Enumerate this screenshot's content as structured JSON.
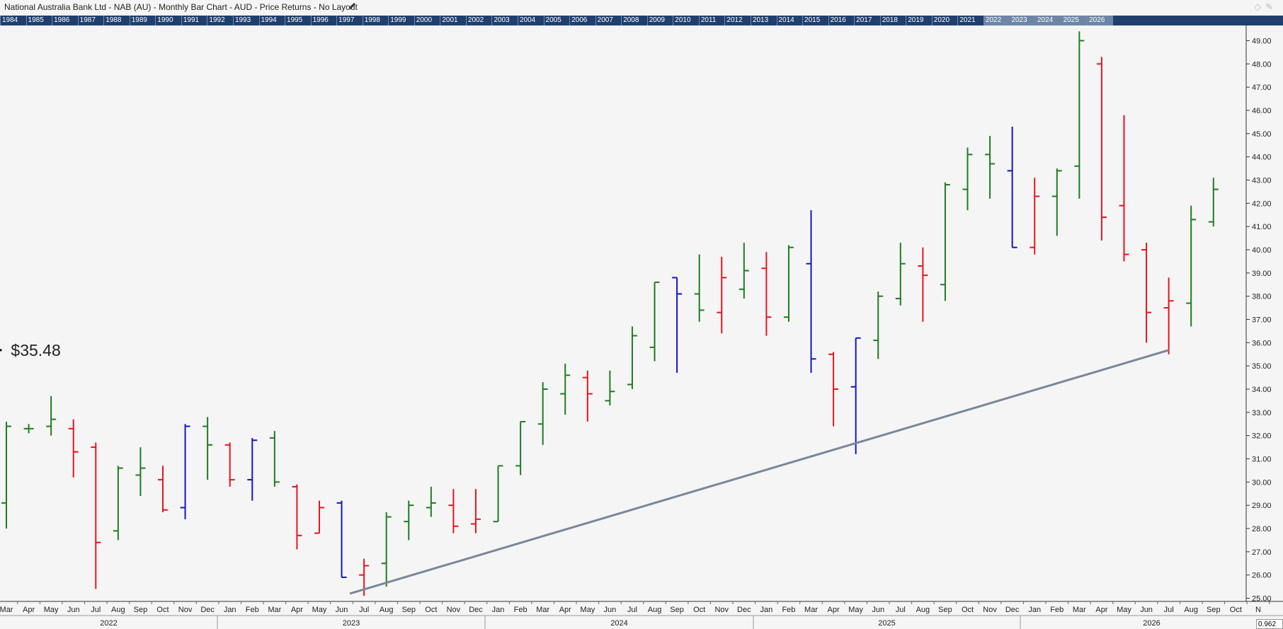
{
  "header": {
    "title": "National Australia Bank Ltd - NAB (AU) - Monthly Bar Chart - AUD - Price Returns - No Layout",
    "edit_icon": "pencil-icon",
    "window_icons": [
      "diamond-icon",
      "pin-icon"
    ]
  },
  "year_strip": {
    "years": [
      "1984",
      "1985",
      "1986",
      "1987",
      "1988",
      "1989",
      "1990",
      "1991",
      "1992",
      "1993",
      "1994",
      "1995",
      "1996",
      "1997",
      "1998",
      "1999",
      "2000",
      "2001",
      "2002",
      "2003",
      "2004",
      "2005",
      "2006",
      "2007",
      "2008",
      "2009",
      "2010",
      "2011",
      "2012",
      "2013",
      "2014",
      "2015",
      "2016",
      "2017",
      "2018",
      "2019",
      "2020",
      "2021",
      "2022",
      "2023",
      "2024",
      "2025",
      "2026"
    ],
    "highlight_from": "2022",
    "highlight_to": "2026"
  },
  "price_label": "$35.48",
  "status_value": "0.962",
  "colors": {
    "up": "#1e7d1e",
    "down": "#e8141e",
    "outside": "#1414c8",
    "trendline": "#778899",
    "level": "#000000"
  },
  "chart_data": {
    "type": "ohlc",
    "title": "National Australia Bank Ltd - NAB (AU) - Monthly Bar Chart - AUD - Price Returns - No Layout",
    "grid": false,
    "ylim": [
      25.0,
      49.5
    ],
    "y_ticks": [
      "25.00",
      "26.00",
      "27.00",
      "28.00",
      "29.00",
      "30.00",
      "31.00",
      "32.00",
      "33.00",
      "34.00",
      "35.00",
      "36.00",
      "37.00",
      "38.00",
      "39.00",
      "40.00",
      "41.00",
      "42.00",
      "43.00",
      "44.00",
      "45.00",
      "46.00",
      "47.00",
      "48.00",
      "49.00"
    ],
    "x_month_labels": [
      "Mar",
      "Apr",
      "May",
      "Jun",
      "Jul",
      "Aug",
      "Sep",
      "Oct",
      "Nov",
      "Dec",
      "Jan",
      "Feb",
      "Mar",
      "Apr",
      "May",
      "Jun",
      "Jul",
      "Aug",
      "Sep",
      "Oct",
      "Nov",
      "Dec",
      "Jan",
      "Feb",
      "Mar",
      "Apr",
      "May",
      "Jun",
      "Jul",
      "Aug",
      "Sep",
      "Oct",
      "Nov",
      "Dec",
      "Jan",
      "Feb",
      "Mar",
      "Apr",
      "May",
      "Jun",
      "Jul",
      "Aug",
      "Sep",
      "Oct",
      "Nov",
      "Dec",
      "Jan",
      "Feb",
      "Mar",
      "Apr",
      "May",
      "Jun",
      "Jul",
      "Aug",
      "Sep",
      "Oct",
      "N"
    ],
    "x_year_labels": [
      "2022",
      "2023",
      "2024",
      "2025",
      "2026"
    ],
    "series": [
      {
        "bars": [
          {
            "month": "Mar 2022",
            "o": 29.1,
            "h": 32.6,
            "l": 28.0,
            "c": 32.4,
            "color": "up"
          },
          {
            "month": "Apr 2022",
            "o": 32.3,
            "h": 32.5,
            "l": 32.1,
            "c": 32.3,
            "color": "up"
          },
          {
            "month": "May 2022",
            "o": 32.4,
            "h": 33.7,
            "l": 32.0,
            "c": 32.7,
            "color": "up"
          },
          {
            "month": "Jun 2022",
            "o": 32.3,
            "h": 32.7,
            "l": 30.2,
            "c": 31.3,
            "color": "down"
          },
          {
            "month": "Jul 2022",
            "o": 31.5,
            "h": 31.7,
            "l": 25.4,
            "c": 27.4,
            "color": "down"
          },
          {
            "month": "Aug 2022",
            "o": 27.9,
            "h": 30.7,
            "l": 27.5,
            "c": 30.6,
            "color": "up"
          },
          {
            "month": "Sep 2022",
            "o": 30.3,
            "h": 31.5,
            "l": 29.4,
            "c": 30.6,
            "color": "up"
          },
          {
            "month": "Oct 2022",
            "o": 30.1,
            "h": 30.7,
            "l": 28.7,
            "c": 28.8,
            "color": "down"
          },
          {
            "month": "Nov 2022",
            "o": 28.9,
            "h": 32.5,
            "l": 28.4,
            "c": 32.4,
            "color": "outside"
          },
          {
            "month": "Dec 2022",
            "o": 32.4,
            "h": 32.8,
            "l": 30.1,
            "c": 31.6,
            "color": "up"
          },
          {
            "month": "Jan 2023",
            "o": 31.6,
            "h": 31.7,
            "l": 29.8,
            "c": 30.1,
            "color": "down"
          },
          {
            "month": "Feb 2023",
            "o": 30.1,
            "h": 31.9,
            "l": 29.2,
            "c": 31.8,
            "color": "outside"
          },
          {
            "month": "Mar 2023",
            "o": 31.9,
            "h": 32.2,
            "l": 29.8,
            "c": 30.0,
            "color": "up"
          },
          {
            "month": "Apr 2023",
            "o": 29.8,
            "h": 29.9,
            "l": 27.1,
            "c": 27.7,
            "color": "down"
          },
          {
            "month": "May 2023",
            "o": 27.8,
            "h": 29.2,
            "l": 27.8,
            "c": 28.9,
            "color": "down"
          },
          {
            "month": "Jun 2023",
            "o": 29.1,
            "h": 29.2,
            "l": 25.9,
            "c": 25.9,
            "color": "outside"
          },
          {
            "month": "Jul 2023",
            "o": 26.0,
            "h": 26.7,
            "l": 25.1,
            "c": 26.4,
            "color": "down"
          },
          {
            "month": "Aug 2023",
            "o": 26.5,
            "h": 28.7,
            "l": 25.5,
            "c": 28.5,
            "color": "up"
          },
          {
            "month": "Sep 2023",
            "o": 28.3,
            "h": 29.2,
            "l": 27.5,
            "c": 29.0,
            "color": "up"
          },
          {
            "month": "Oct 2023",
            "o": 28.9,
            "h": 29.8,
            "l": 28.5,
            "c": 29.1,
            "color": "up"
          },
          {
            "month": "Nov 2023",
            "o": 29.0,
            "h": 29.7,
            "l": 27.8,
            "c": 28.1,
            "color": "down"
          },
          {
            "month": "Dec 2023",
            "o": 28.2,
            "h": 29.7,
            "l": 27.8,
            "c": 28.4,
            "color": "down"
          },
          {
            "month": "Jan 2024",
            "o": 28.3,
            "h": 30.7,
            "l": 28.3,
            "c": 30.7,
            "color": "up"
          },
          {
            "month": "Feb 2024",
            "o": 30.7,
            "h": 32.6,
            "l": 30.3,
            "c": 32.6,
            "color": "up"
          },
          {
            "month": "Mar 2024",
            "o": 32.5,
            "h": 34.3,
            "l": 31.6,
            "c": 34.0,
            "color": "up"
          },
          {
            "month": "Apr 2024",
            "o": 33.8,
            "h": 35.1,
            "l": 32.9,
            "c": 34.6,
            "color": "up"
          },
          {
            "month": "May 2024",
            "o": 34.5,
            "h": 34.8,
            "l": 32.6,
            "c": 33.8,
            "color": "down"
          },
          {
            "month": "Jun 2024",
            "o": 33.5,
            "h": 34.8,
            "l": 33.3,
            "c": 33.9,
            "color": "up"
          },
          {
            "month": "Jul 2024",
            "o": 34.2,
            "h": 36.7,
            "l": 34.0,
            "c": 36.3,
            "color": "up"
          },
          {
            "month": "Aug 2024",
            "o": 35.8,
            "h": 38.6,
            "l": 35.2,
            "c": 38.6,
            "color": "up"
          },
          {
            "month": "Sep 2024",
            "o": 38.8,
            "h": 38.8,
            "l": 34.7,
            "c": 38.1,
            "color": "outside"
          },
          {
            "month": "Oct 2024",
            "o": 38.1,
            "h": 39.8,
            "l": 36.9,
            "c": 37.4,
            "color": "up"
          },
          {
            "month": "Nov 2024",
            "o": 37.3,
            "h": 39.7,
            "l": 36.4,
            "c": 38.8,
            "color": "down"
          },
          {
            "month": "Dec 2024",
            "o": 38.3,
            "h": 40.3,
            "l": 37.9,
            "c": 39.1,
            "color": "up"
          },
          {
            "month": "Jan 2025",
            "o": 39.2,
            "h": 39.9,
            "l": 36.3,
            "c": 37.1,
            "color": "down"
          },
          {
            "month": "Feb 2025",
            "o": 37.1,
            "h": 40.2,
            "l": 36.9,
            "c": 40.1,
            "color": "up"
          },
          {
            "month": "Mar 2025",
            "o": 39.4,
            "h": 41.7,
            "l": 34.7,
            "c": 35.3,
            "color": "outside"
          },
          {
            "month": "Apr 2025",
            "o": 35.5,
            "h": 35.6,
            "l": 32.4,
            "c": 34.0,
            "color": "down"
          },
          {
            "month": "May 2025",
            "o": 34.1,
            "h": 36.2,
            "l": 31.2,
            "c": 36.2,
            "color": "outside"
          },
          {
            "month": "Jun 2025",
            "o": 36.1,
            "h": 38.2,
            "l": 35.3,
            "c": 38.0,
            "color": "up"
          },
          {
            "month": "Jul 2025",
            "o": 37.9,
            "h": 40.3,
            "l": 37.6,
            "c": 39.4,
            "color": "up"
          },
          {
            "month": "Aug 2025",
            "o": 39.3,
            "h": 40.1,
            "l": 36.9,
            "c": 38.9,
            "color": "down"
          },
          {
            "month": "Sep 2025",
            "o": 38.5,
            "h": 42.9,
            "l": 37.8,
            "c": 42.8,
            "color": "up"
          },
          {
            "month": "Oct 2025",
            "o": 42.6,
            "h": 44.4,
            "l": 41.7,
            "c": 44.1,
            "color": "up"
          },
          {
            "month": "Nov 2025",
            "o": 44.1,
            "h": 44.9,
            "l": 42.2,
            "c": 43.7,
            "color": "up"
          },
          {
            "month": "Dec 2025",
            "o": 43.4,
            "h": 45.3,
            "l": 40.1,
            "c": 40.1,
            "color": "outside"
          },
          {
            "month": "Jan 2026",
            "o": 40.1,
            "h": 43.1,
            "l": 39.8,
            "c": 42.3,
            "color": "down"
          },
          {
            "month": "Feb 2026",
            "o": 42.3,
            "h": 43.5,
            "l": 40.6,
            "c": 43.4,
            "color": "up"
          },
          {
            "month": "Mar 2026",
            "o": 43.6,
            "h": 49.4,
            "l": 42.2,
            "c": 49.0,
            "color": "up"
          },
          {
            "month": "Apr 2026",
            "o": 48.0,
            "h": 48.3,
            "l": 40.4,
            "c": 41.4,
            "color": "down"
          },
          {
            "month": "May 2026",
            "o": 41.9,
            "h": 45.8,
            "l": 39.5,
            "c": 39.8,
            "color": "down"
          },
          {
            "month": "Jun 2026",
            "o": 40.0,
            "h": 40.3,
            "l": 36.0,
            "c": 37.3,
            "color": "down"
          },
          {
            "month": "Jul 2026",
            "o": 37.5,
            "h": 38.8,
            "l": 35.5,
            "c": 37.8,
            "color": "down"
          },
          {
            "month": "Aug 2026",
            "o": 37.7,
            "h": 41.9,
            "l": 36.7,
            "c": 41.3,
            "color": "up"
          },
          {
            "month": "Sep 2026",
            "o": 41.2,
            "h": 43.1,
            "l": 41.0,
            "c": 42.6,
            "color": "up"
          }
        ]
      }
    ],
    "annotations": [
      {
        "type": "hline",
        "y": 35.68,
        "from": "Jun 2025",
        "to": "Jul 2026",
        "label": "$35.48"
      },
      {
        "type": "trendline",
        "from": {
          "month": "Jul 2023",
          "y": 25.2
        },
        "to": {
          "month": "Jul 2026",
          "y": 35.68
        }
      }
    ]
  }
}
